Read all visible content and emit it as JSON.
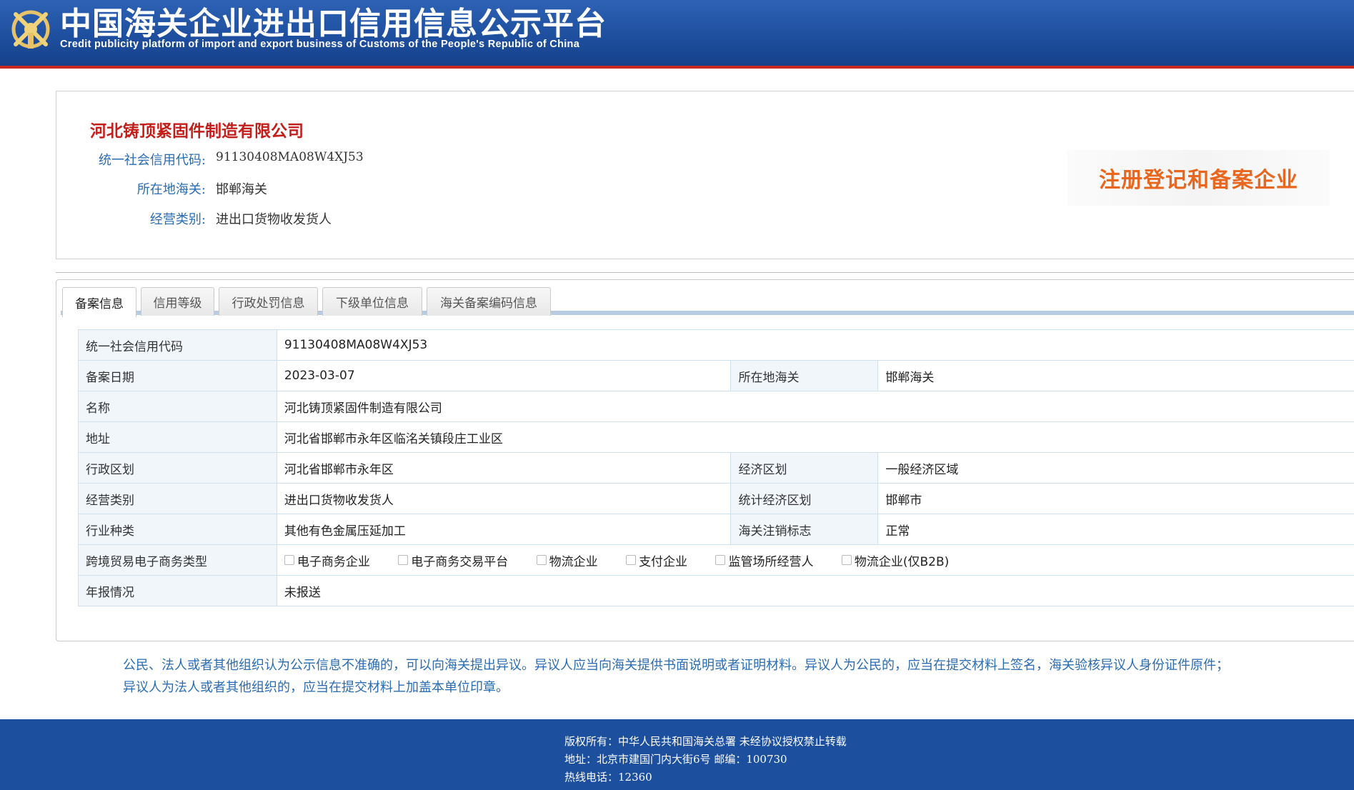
{
  "header": {
    "title": "中国海关企业进出口信用信息公示平台",
    "subtitle": "Credit publicity platform of import and export business of Customs of the People's Republic of China"
  },
  "company": {
    "name": "河北铸顶紧固件制造有限公司",
    "fields": [
      {
        "label": "统一社会信用代码:",
        "value": "91130408MA08W4XJ53"
      },
      {
        "label": "所在地海关:",
        "value": "邯郸海关"
      },
      {
        "label": "经营类别:",
        "value": "进出口货物收发货人"
      }
    ],
    "stamp": "注册登记和备案企业"
  },
  "tabs": [
    {
      "label": "备案信息",
      "active": true
    },
    {
      "label": "信用等级",
      "active": false
    },
    {
      "label": "行政处罚信息",
      "active": false
    },
    {
      "label": "下级单位信息",
      "active": false
    },
    {
      "label": "海关备案编码信息",
      "active": false
    }
  ],
  "record": {
    "credit_code_label": "统一社会信用代码",
    "credit_code": "91130408MA08W4XJ53",
    "date_label": "备案日期",
    "date": "2023-03-07",
    "customs_label": "所在地海关",
    "customs": "邯郸海关",
    "name_label": "名称",
    "name": "河北铸顶紧固件制造有限公司",
    "address_label": "地址",
    "address": "河北省邯郸市永年区临洺关镇段庄工业区",
    "admin_region_label": "行政区划",
    "admin_region": "河北省邯郸市永年区",
    "econ_region_label": "经济区划",
    "econ_region": "一般经济区域",
    "biz_type_label": "经营类别",
    "biz_type": "进出口货物收发货人",
    "stat_region_label": "统计经济区划",
    "stat_region": "邯郸市",
    "industry_label": "行业种类",
    "industry": "其他有色金属压延加工",
    "cancel_flag_label": "海关注销标志",
    "cancel_flag": "正常",
    "ecommerce_label": "跨境贸易电子商务类型",
    "ecommerce_options": [
      "电子商务企业",
      "电子商务交易平台",
      "物流企业",
      "支付企业",
      "监管场所经营人",
      "物流企业(仅B2B)"
    ],
    "annual_report_label": "年报情况",
    "annual_report": "未报送"
  },
  "notice": {
    "line1": "公民、法人或者其他组织认为公示信息不准确的，可以向海关提出异议。异议人应当向海关提供书面说明或者证明材料。异议人为公民的，应当在提交材料上签名，海关验核异议人身份证件原件；",
    "line2": "异议人为法人或者其他组织的，应当在提交材料上加盖本单位印章。"
  },
  "footer": {
    "copyright": "版权所有：中华人民共和国海关总署   未经协议授权禁止转载",
    "address": "地址：北京市建国门内大街6号 邮编：100730",
    "hotline": "热线电话：12360"
  },
  "colors": {
    "header_blue": "#1e4f9f",
    "header_red_line": "#c9281e",
    "company_red": "#c21f1a",
    "label_blue": "#2a6cb3",
    "stamp_orange": "#e8661e",
    "footer_blue": "#1c4f9e"
  }
}
